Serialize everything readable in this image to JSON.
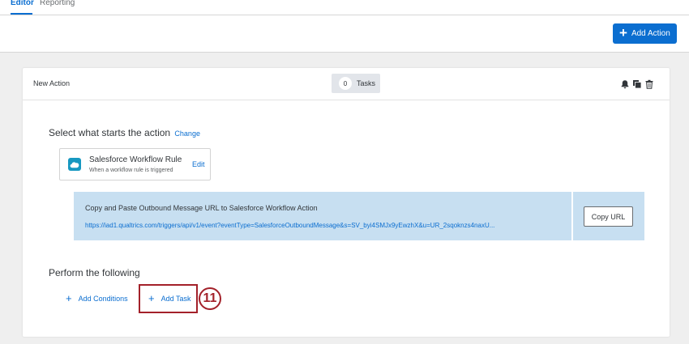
{
  "tabs": [
    {
      "label": "Editor",
      "active": true
    },
    {
      "label": "Reporting",
      "active": false
    }
  ],
  "toolbar": {
    "add_action_label": "Add Action",
    "add_action_icon": "plus-icon"
  },
  "colors": {
    "accent": "#0b6ed0",
    "highlight": "#a3212a",
    "url_panel": "#c7dff1"
  },
  "action": {
    "title": "New Action",
    "tasks_count": "0",
    "tasks_label": "Tasks",
    "header_icons": [
      "bell-icon",
      "copy-icon",
      "trash-icon"
    ]
  },
  "trigger_section": {
    "title": "Select what starts the action",
    "change_label": "Change",
    "trigger": {
      "name": "Salesforce Workflow Rule",
      "subtitle": "When a workflow rule is triggered",
      "edit_label": "Edit",
      "icon": "salesforce-cloud-icon"
    },
    "outbound": {
      "title": "Copy and Paste Outbound Message URL to Salesforce Workflow Action",
      "url": "https://iad1.qualtrics.com/triggers/api/v1/event?eventType=SalesforceOutboundMessage&s=SV_byi4SMJx9yEwzhX&u=UR_2sqoknzs4naxU...",
      "copy_label": "Copy URL"
    }
  },
  "perform_section": {
    "title": "Perform the following",
    "add_conditions_label": "Add Conditions",
    "add_task_label": "Add Task"
  },
  "callout": {
    "step_number": "11"
  }
}
